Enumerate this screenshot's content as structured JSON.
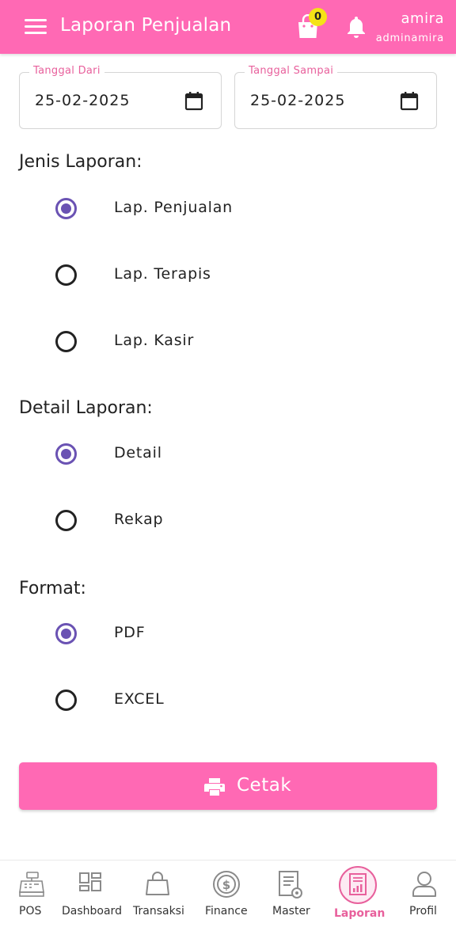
{
  "header": {
    "title": "Laporan Penjualan",
    "cart_count": "0",
    "user_name": "amira",
    "user_id": "adminamira"
  },
  "filters": {
    "date_from": {
      "label": "Tanggal Dari",
      "value": "25-02-2025"
    },
    "date_to": {
      "label": "Tanggal Sampai",
      "value": "25-02-2025"
    }
  },
  "jenis": {
    "title": "Jenis Laporan:",
    "options": [
      "Lap. Penjualan",
      "Lap. Terapis",
      "Lap. Kasir"
    ],
    "selected": "Lap. Penjualan"
  },
  "detail": {
    "title": "Detail Laporan:",
    "options": [
      "Detail",
      "Rekap"
    ],
    "selected": "Detail"
  },
  "format": {
    "title": "Format:",
    "options": [
      "PDF",
      "EXCEL"
    ],
    "selected": "PDF"
  },
  "action": {
    "label": "Cetak"
  },
  "nav": {
    "items": [
      {
        "label": "POS",
        "icon": "cash-register-icon"
      },
      {
        "label": "Dashboard",
        "icon": "dashboard-grid-icon"
      },
      {
        "label": "Transaksi",
        "icon": "shopping-bag-icon"
      },
      {
        "label": "Finance",
        "icon": "dollar-coin-icon"
      },
      {
        "label": "Master",
        "icon": "document-gear-icon"
      },
      {
        "label": "Laporan",
        "icon": "report-chart-icon"
      },
      {
        "label": "Profil",
        "icon": "user-icon"
      }
    ],
    "active": "Laporan"
  },
  "colors": {
    "primary": "#ff69b4",
    "radio_selected": "#6a52b3",
    "badge": "#f5e317",
    "field_label": "#e8609c"
  }
}
